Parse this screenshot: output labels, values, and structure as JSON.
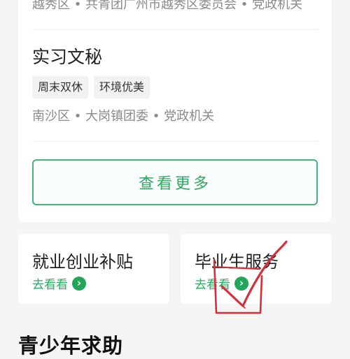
{
  "top_card": {
    "previous_meta": "越秀区 • 共青团广州市越秀区委员会 • 党政机关",
    "job_title": "实习文秘",
    "tags": [
      "周末双休",
      "环境优美"
    ],
    "job_meta": "南沙区 • 大岗镇团委 • 党政机关",
    "more_button_label": "查看更多",
    "accent_color": "#2fa866"
  },
  "services": [
    {
      "title": "就业创业补贴",
      "link_label": "去看看",
      "icon": "arrow-right-circle-icon"
    },
    {
      "title": "毕业生服务",
      "link_label": "去看看",
      "icon": "arrow-right-circle-icon"
    }
  ],
  "section_heading": "青少年求助",
  "annotation": {
    "shape": "red-checkmark-scribble",
    "color": "#d3303a"
  }
}
